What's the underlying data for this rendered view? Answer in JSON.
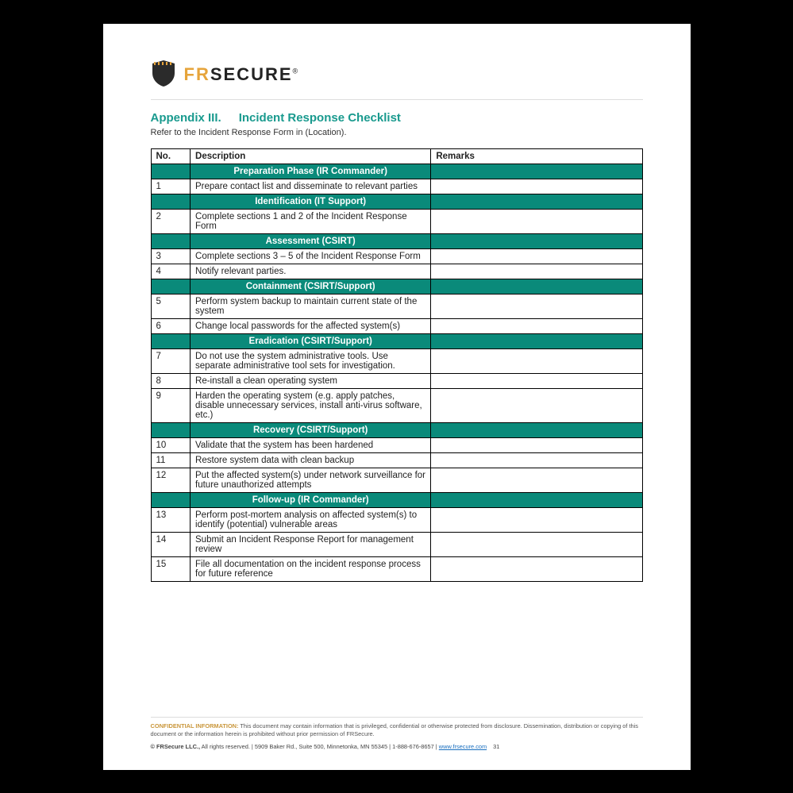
{
  "brand": {
    "name_pre": "FR",
    "name_post": "SECURE",
    "registered": "®"
  },
  "heading": {
    "appendix": "Appendix III.",
    "title": "Incident Response Checklist",
    "subtext": "Refer to the Incident Response Form in (Location)."
  },
  "columns": {
    "no": "No.",
    "desc": "Description",
    "remarks": "Remarks"
  },
  "table": [
    {
      "type": "section",
      "label": "Preparation Phase (IR Commander)"
    },
    {
      "type": "row",
      "no": "1",
      "desc": "Prepare contact list and disseminate to relevant parties",
      "remarks": ""
    },
    {
      "type": "section",
      "label": "Identification (IT Support)"
    },
    {
      "type": "row",
      "no": "2",
      "desc": "Complete sections 1 and 2 of the Incident Response Form",
      "remarks": ""
    },
    {
      "type": "section",
      "label": "Assessment (CSIRT)"
    },
    {
      "type": "row",
      "no": "3",
      "desc": "Complete sections 3 – 5 of the Incident Response Form",
      "remarks": ""
    },
    {
      "type": "row",
      "no": "4",
      "desc": "Notify relevant parties.",
      "remarks": ""
    },
    {
      "type": "section",
      "label": "Containment (CSIRT/Support)"
    },
    {
      "type": "row",
      "no": "5",
      "desc": "Perform system backup to maintain current state of the system",
      "remarks": ""
    },
    {
      "type": "row",
      "no": "6",
      "desc": "Change local passwords for the affected system(s)",
      "remarks": ""
    },
    {
      "type": "section",
      "label": "Eradication (CSIRT/Support)"
    },
    {
      "type": "row",
      "no": "7",
      "desc": "Do not use the system administrative tools. Use separate administrative tool sets for investigation.",
      "remarks": ""
    },
    {
      "type": "row",
      "no": "8",
      "desc": "Re-install a clean operating system",
      "remarks": ""
    },
    {
      "type": "row",
      "no": "9",
      "desc": "Harden the operating system (e.g. apply patches, disable unnecessary services, install anti-virus software, etc.)",
      "remarks": ""
    },
    {
      "type": "section",
      "label": "Recovery (CSIRT/Support)"
    },
    {
      "type": "row",
      "no": "10",
      "desc": "Validate that the system has been hardened",
      "remarks": ""
    },
    {
      "type": "row",
      "no": "11",
      "desc": "Restore system data with clean backup",
      "remarks": ""
    },
    {
      "type": "row",
      "no": "12",
      "desc": "Put the affected system(s) under network surveillance for future unauthorized attempts",
      "remarks": ""
    },
    {
      "type": "section",
      "label": "Follow-up (IR Commander)"
    },
    {
      "type": "row",
      "no": "13",
      "desc": "Perform post-mortem analysis on affected system(s) to identify (potential) vulnerable areas",
      "remarks": ""
    },
    {
      "type": "row",
      "no": "14",
      "desc": "Submit an Incident Response Report for management review",
      "remarks": ""
    },
    {
      "type": "row",
      "no": "15",
      "desc": "File all documentation on the incident response process for future reference",
      "remarks": ""
    }
  ],
  "footer": {
    "conf_label": "CONFIDENTIAL INFORMATION:",
    "conf_text": "This document may contain information that is privileged, confidential or otherwise protected from disclosure. Dissemination, distribution or copying of this document or the information herein is prohibited without prior permission of FRSecure.",
    "line2_pre": "© FRSecure LLC.,",
    "line2_rest": " All rights reserved. | 5909 Baker Rd., Suite 500, Minnetonka, MN 55345 | 1-888-676-8657 | ",
    "link": "www.frsecure.com",
    "page": "31"
  }
}
